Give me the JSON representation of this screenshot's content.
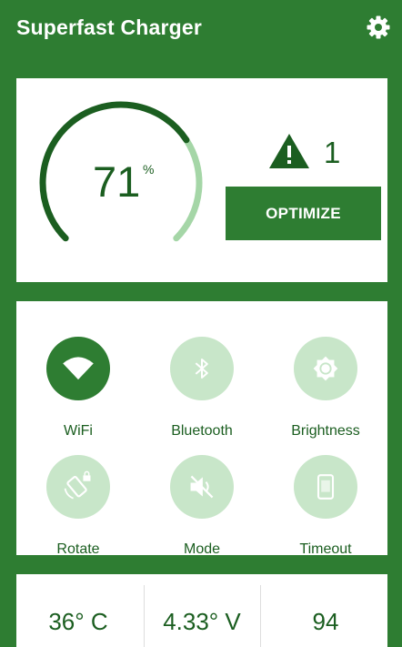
{
  "app": {
    "title": "Superfast Charger",
    "settings_icon": "gear-icon"
  },
  "battery": {
    "percent_value": "71",
    "percent_unit": "%",
    "level_fraction": 0.71,
    "arc_color": "#1b5e20",
    "track_color": "#a5d6a7"
  },
  "warnings": {
    "icon": "warning-triangle-icon",
    "count": "1"
  },
  "optimize": {
    "label": "OPTIMIZE"
  },
  "toggles": [
    {
      "label": "WiFi",
      "icon": "wifi-icon",
      "active": true
    },
    {
      "label": "Bluetooth",
      "icon": "bluetooth-icon",
      "active": false
    },
    {
      "label": "Brightness",
      "icon": "brightness-icon",
      "active": false
    },
    {
      "label": "Rotate",
      "icon": "rotate-lock-icon",
      "active": false
    },
    {
      "label": "Mode",
      "icon": "speaker-muted-icon",
      "active": false
    },
    {
      "label": "Timeout",
      "icon": "phone-timeout-icon",
      "active": false
    }
  ],
  "stats": {
    "temperature": "36° C",
    "voltage": "4.33° V",
    "third": "94"
  },
  "colors": {
    "primary": "#2e7d32",
    "primary_dark": "#1b5e20",
    "inactive_circle": "#c8e6c9"
  }
}
